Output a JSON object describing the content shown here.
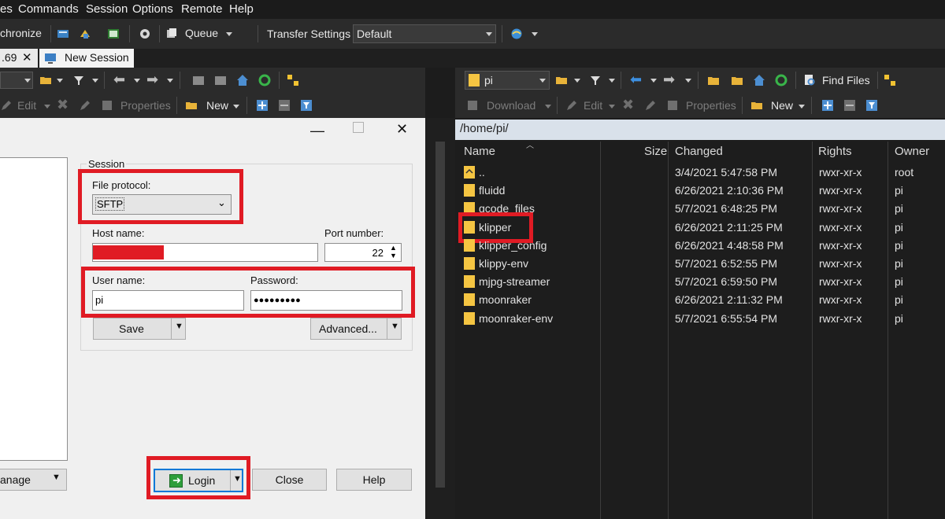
{
  "menubar": {
    "items": [
      "es",
      "Commands",
      "Session",
      "Options",
      "Remote",
      "Help"
    ]
  },
  "toolbar": {
    "synchronize_label": "chronize",
    "queue_label": "Queue",
    "transfer_settings_label": "Transfer Settings",
    "transfer_settings_value": "Default"
  },
  "tabs": {
    "session_tab_label": ".69",
    "new_session_label": "New Session"
  },
  "left_pane": {
    "edit_label": "Edit",
    "properties_label": "Properties",
    "new_label": "New"
  },
  "right_pane": {
    "dir_value": "pi",
    "find_files_label": "Find Files",
    "download_label": "Download",
    "edit_label": "Edit",
    "properties_label": "Properties",
    "new_label": "New",
    "path": "/home/pi/",
    "columns": {
      "name": "Name",
      "size": "Size",
      "changed": "Changed",
      "rights": "Rights",
      "owner": "Owner"
    },
    "files": [
      {
        "name": "..",
        "changed": "3/4/2021 5:47:58 PM",
        "rights": "rwxr-xr-x",
        "owner": "root"
      },
      {
        "name": "fluidd",
        "changed": "6/26/2021 2:10:36 PM",
        "rights": "rwxr-xr-x",
        "owner": "pi"
      },
      {
        "name": "gcode_files",
        "changed": "5/7/2021 6:48:25 PM",
        "rights": "rwxr-xr-x",
        "owner": "pi"
      },
      {
        "name": "klipper",
        "changed": "6/26/2021 2:11:25 PM",
        "rights": "rwxr-xr-x",
        "owner": "pi"
      },
      {
        "name": "klipper_config",
        "changed": "6/26/2021 4:48:58 PM",
        "rights": "rwxr-xr-x",
        "owner": "pi"
      },
      {
        "name": "klippy-env",
        "changed": "5/7/2021 6:52:55 PM",
        "rights": "rwxr-xr-x",
        "owner": "pi"
      },
      {
        "name": "mjpg-streamer",
        "changed": "5/7/2021 6:59:50 PM",
        "rights": "rwxr-xr-x",
        "owner": "pi"
      },
      {
        "name": "moonraker",
        "changed": "6/26/2021 2:11:32 PM",
        "rights": "rwxr-xr-x",
        "owner": "pi"
      },
      {
        "name": "moonraker-env",
        "changed": "5/7/2021 6:55:54 PM",
        "rights": "rwxr-xr-x",
        "owner": "pi"
      }
    ]
  },
  "login_dialog": {
    "session_group_label": "Session",
    "file_protocol_label": "File protocol:",
    "file_protocol_value": "SFTP",
    "host_name_label": "Host name:",
    "port_number_label": "Port number:",
    "port_number_value": "22",
    "user_name_label": "User name:",
    "user_name_value": "pi",
    "password_label": "Password:",
    "password_value": "●●●●●●●●●",
    "save_label": "Save",
    "advanced_label": "Advanced...",
    "manage_label": "anage",
    "login_label": "Login",
    "close_label": "Close",
    "help_label": "Help"
  },
  "colors": {
    "highlight_red": "#e01b24",
    "app_background": "#1c1c1c",
    "dialog_background": "#f0f0f0",
    "folder_yellow": "#f5c542"
  }
}
